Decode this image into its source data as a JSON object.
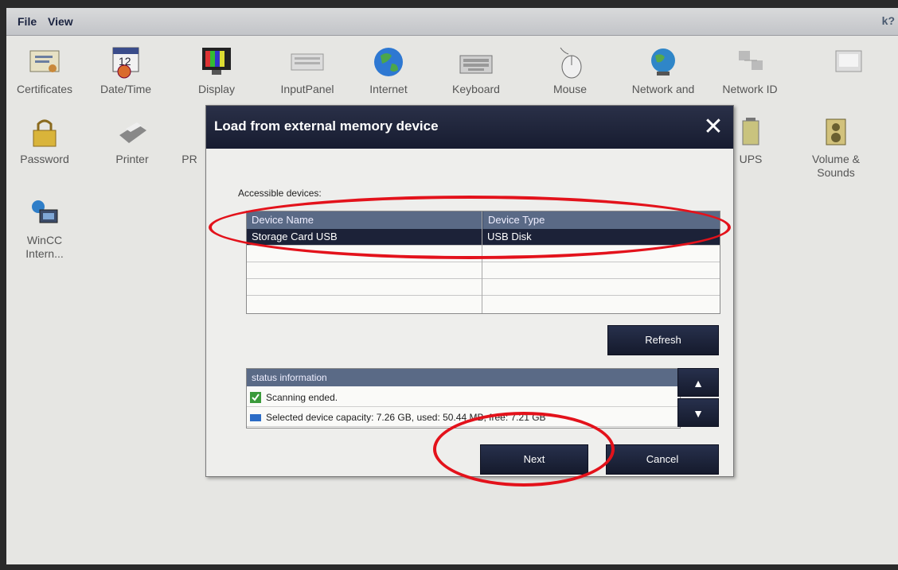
{
  "menubar": {
    "file": "File",
    "view": "View",
    "help_glyph": "k?"
  },
  "control_panel": {
    "row1": [
      "Certificates",
      "Date/Time",
      "Display",
      "InputPanel",
      "Internet",
      "Keyboard",
      "Mouse",
      "Network and",
      "Network ID"
    ],
    "row2": [
      "Password",
      "Printer",
      "PR",
      "UPS",
      "Volume &",
      "Sounds"
    ],
    "row3": [
      "WinCC",
      "Intern..."
    ],
    "date_icon_text": "1 2"
  },
  "dialog": {
    "title": "Load from external memory device",
    "close_glyph": "✕",
    "accessible_label": "Accessible devices:",
    "table": {
      "columns": [
        "Device Name",
        "Device Type"
      ],
      "rows": [
        [
          "Storage Card USB",
          "USB Disk"
        ]
      ]
    },
    "refresh_label": "Refresh",
    "status": {
      "header": "status information",
      "lines": [
        "Scanning ended.",
        "Selected device capacity: 7.26 GB, used: 50.44 MB, free: 7.21 GB"
      ]
    },
    "scroll_up_glyph": "▲",
    "scroll_down_glyph": "▼",
    "next_label": "Next",
    "cancel_label": "Cancel"
  },
  "colors": {
    "annotation": "#e3121b",
    "dark_button": "#1c2238",
    "header_blue": "#5a6a86"
  }
}
